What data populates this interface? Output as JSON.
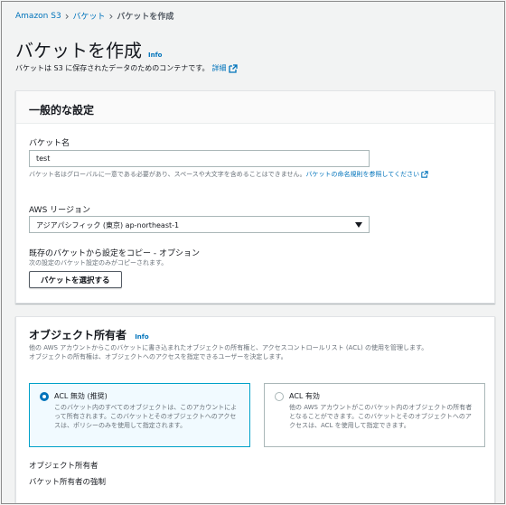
{
  "breadcrumb": {
    "root": "Amazon S3",
    "parent": "バケット",
    "current": "バケットを作成"
  },
  "page": {
    "title": "バケットを作成",
    "info": "Info",
    "description": "バケットは S3 に保存されたデータのためのコンテナです。",
    "detail_link": "詳細"
  },
  "general": {
    "title": "一般的な設定",
    "bucket_name_label": "バケット名",
    "bucket_name_value": "test",
    "bucket_name_desc": "バケット名はグローバルに一意である必要があり、スペースや大文字を含めることはできません。",
    "bucket_name_rules_link": "バケットの命名規則を参照してください",
    "region_label": "AWS リージョン",
    "region_value": "アジアパシフィック (東京) ap-northeast-1",
    "copy_label": "既存のバケットから設定をコピー - オプション",
    "copy_desc": "次の設定のバケット設定のみがコピーされます。",
    "choose_bucket_button": "バケットを選択する"
  },
  "ownership": {
    "title": "オブジェクト所有者",
    "info": "Info",
    "desc_line1": "他の AWS アカウントからこのバケットに書き込まれたオブジェクトの所有権と、アクセスコントロールリスト (ACL) の使用を管理します。",
    "desc_line2": "オブジェクトの所有権は、オブジェクトへのアクセスを指定できるユーザーを決定します。",
    "option_disabled_title": "ACL 無効 (推奨)",
    "option_disabled_desc": "このバケット内のすべてのオブジェクトは、このアカウントによって所有されます。このバケットとそのオブジェクトへのアクセスは、ポリシーのみを使用して指定されます。",
    "option_enabled_title": "ACL 有効",
    "option_enabled_desc": "他の AWS アカウントがこのバケット内のオブジェクトの所有者となることができます。このバケットとそのオブジェクトへのアクセスは、ACL を使用して指定できます。",
    "owner_label": "オブジェクト所有者",
    "owner_value": "バケット所有者の強制"
  },
  "colors": {
    "link": "#0073bb",
    "selected_border": "#00a1c9",
    "selected_bg": "#f1faff"
  }
}
